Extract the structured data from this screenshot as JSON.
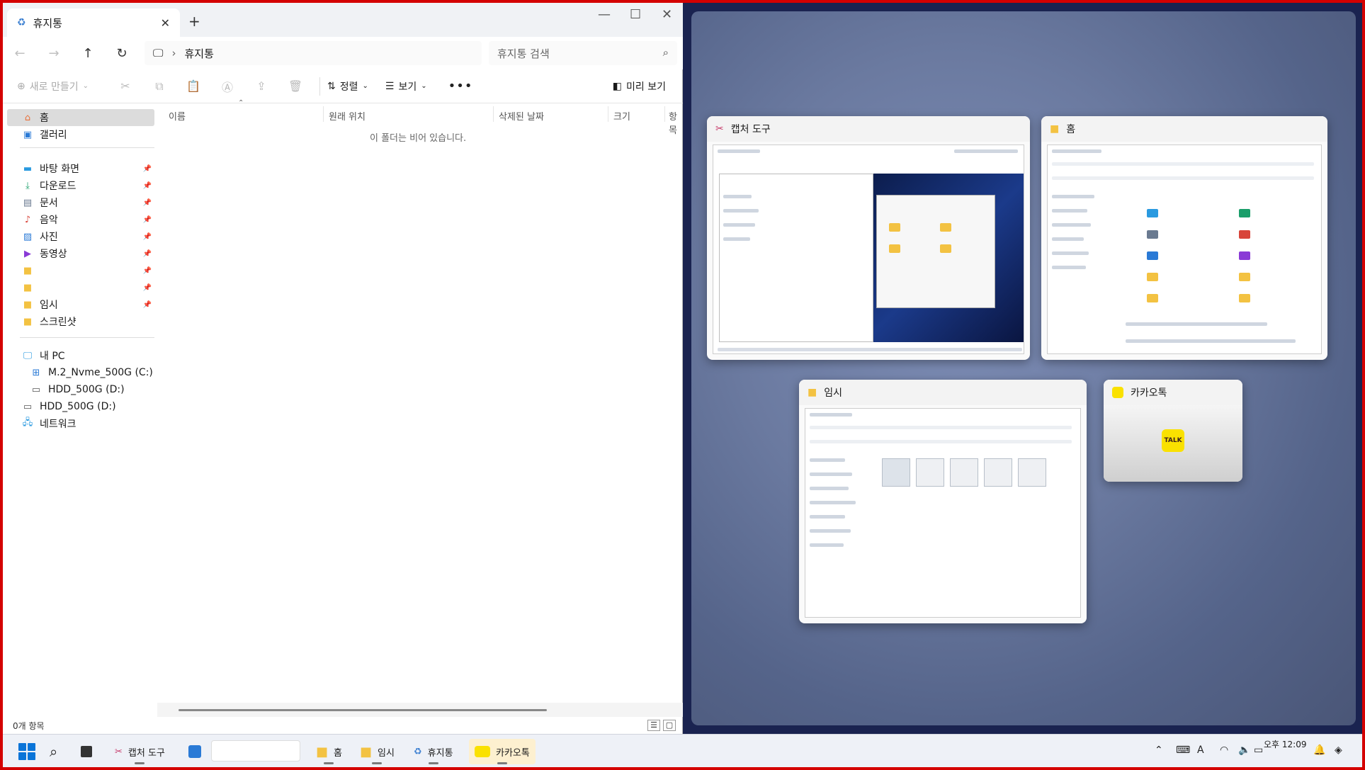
{
  "explorer": {
    "tab_title": "휴지통",
    "address_crumb": "휴지통",
    "search_placeholder": "휴지통 검색",
    "toolbar": {
      "new_label": "새로 만들기",
      "sort_label": "정렬",
      "view_label": "보기",
      "more_label": "•••",
      "preview_label": "미리 보기"
    },
    "sidebar": {
      "home": "홈",
      "gallery": "갤러리",
      "desktop": "바탕 화면",
      "downloads": "다운로드",
      "documents": "문서",
      "music": "음악",
      "pictures": "사진",
      "videos": "동영상",
      "temp": "임시",
      "screenshots": "스크린샷",
      "my_pc": "내 PC",
      "drive_c": "M.2_Nvme_500G (C:)",
      "drive_d": "HDD_500G (D:)",
      "drive_d2": "HDD_500G (D:)",
      "network": "네트워크"
    },
    "columns": [
      "이름",
      "원래 위치",
      "삭제된 날짜",
      "크기",
      "항목"
    ],
    "empty_message": "이 폴더는 비어 있습니다.",
    "status": "0개 항목"
  },
  "snap": {
    "cards": {
      "capture": "캡처 도구",
      "home": "홈",
      "temp": "임시",
      "kakao": "카카오톡"
    },
    "kakao_logo": "TALK"
  },
  "taskbar": {
    "capture": "캡처 도구",
    "home": "홈",
    "temp": "임시",
    "recycle": "휴지통",
    "kakao": "카카오톡",
    "time_ampm": "오후 12:09"
  },
  "colors": {
    "accent": "#0a74d8",
    "folder": "#f3c242",
    "kakao": "#fae100",
    "frame": "#d40000"
  }
}
